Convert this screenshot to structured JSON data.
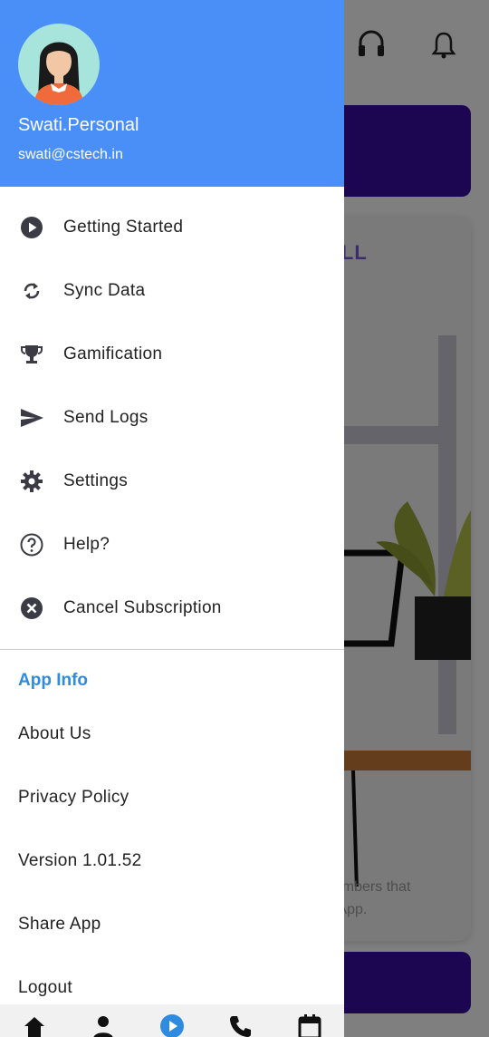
{
  "header": {
    "user_name": "Swati.Personal",
    "user_email": "swati@cstech.in"
  },
  "menu": [
    {
      "label": "Getting Started",
      "icon": "play-circle-icon"
    },
    {
      "label": "Sync Data",
      "icon": "sync-icon"
    },
    {
      "label": "Gamification",
      "icon": "trophy-icon"
    },
    {
      "label": "Send Logs",
      "icon": "send-icon"
    },
    {
      "label": "Settings",
      "icon": "gear-icon"
    },
    {
      "label": "Help?",
      "icon": "help-circle-icon"
    },
    {
      "label": "Cancel Subscription",
      "icon": "cancel-circle-icon"
    }
  ],
  "app_info": {
    "title": "App Info",
    "items": [
      "About Us",
      "Privacy Policy",
      "Version 1.01.52",
      "Share App",
      "Logout"
    ]
  },
  "background": {
    "card_title_fragment": "ALL",
    "card_text_line1": "numbers that",
    "card_text_line2": "e App."
  },
  "colors": {
    "drawer_header": "#4a8ff7",
    "accent_link": "#2f8be0",
    "banner": "#3a0ca3"
  }
}
